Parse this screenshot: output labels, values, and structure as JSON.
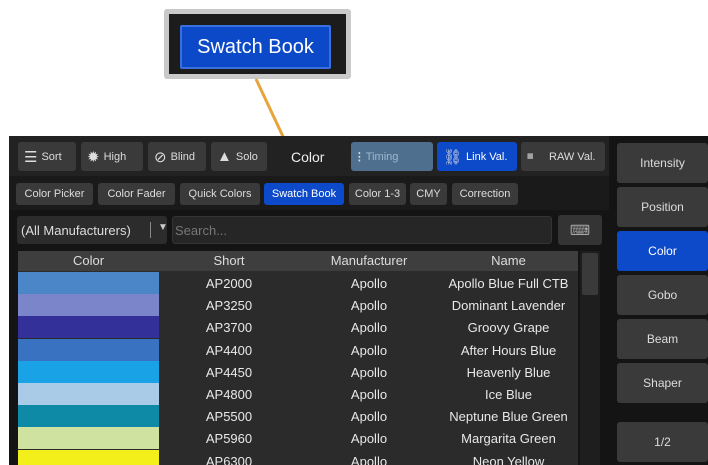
{
  "callout": {
    "label": "Swatch Book"
  },
  "toolbar": {
    "sort": "Sort",
    "high": "High",
    "blind": "Blind",
    "solo": "Solo",
    "title": "Color",
    "timing": "Timing",
    "link_val": "Link Val.",
    "raw_val": "RAW Val.",
    "raw_icon_text": "11010\n01101\n10011"
  },
  "tabs": [
    "Color Picker",
    "Color Fader",
    "Quick Colors",
    "Swatch Book",
    "Color 1-3",
    "CMY",
    "Correction"
  ],
  "active_tab": "Swatch Book",
  "filter": {
    "value": "(All Manufacturers)"
  },
  "search": {
    "placeholder": "Search..."
  },
  "table": {
    "headers": [
      "Color",
      "Short",
      "Manufacturer",
      "Name"
    ],
    "rows": [
      {
        "color": "#4b86c8",
        "short": "AP2000",
        "manufacturer": "Apollo",
        "name": "Apollo Blue Full CTB"
      },
      {
        "color": "#7a86c9",
        "short": "AP3250",
        "manufacturer": "Apollo",
        "name": "Dominant Lavender"
      },
      {
        "color": "#33309a",
        "short": "AP3700",
        "manufacturer": "Apollo",
        "name": "Groovy Grape"
      },
      {
        "color": "#3a72c2",
        "short": "AP4400",
        "manufacturer": "Apollo",
        "name": "After Hours Blue"
      },
      {
        "color": "#1aa2e6",
        "short": "AP4450",
        "manufacturer": "Apollo",
        "name": "Heavenly Blue"
      },
      {
        "color": "#a9cbe8",
        "short": "AP4800",
        "manufacturer": "Apollo",
        "name": "Ice Blue"
      },
      {
        "color": "#0f8aa6",
        "short": "AP5500",
        "manufacturer": "Apollo",
        "name": "Neptune Blue Green"
      },
      {
        "color": "#cfe2a0",
        "short": "AP5960",
        "manufacturer": "Apollo",
        "name": "Margarita Green"
      },
      {
        "color": "#f2ef1a",
        "short": "AP6300",
        "manufacturer": "Apollo",
        "name": "Neon Yellow"
      }
    ]
  },
  "sidebar": [
    "Intensity",
    "Position",
    "Color",
    "Gobo",
    "Beam",
    "Shaper",
    "1/2"
  ],
  "sidebar_active": "Color",
  "colors": {
    "accent": "#0d4ac9",
    "arrow": "#e8a43a"
  }
}
